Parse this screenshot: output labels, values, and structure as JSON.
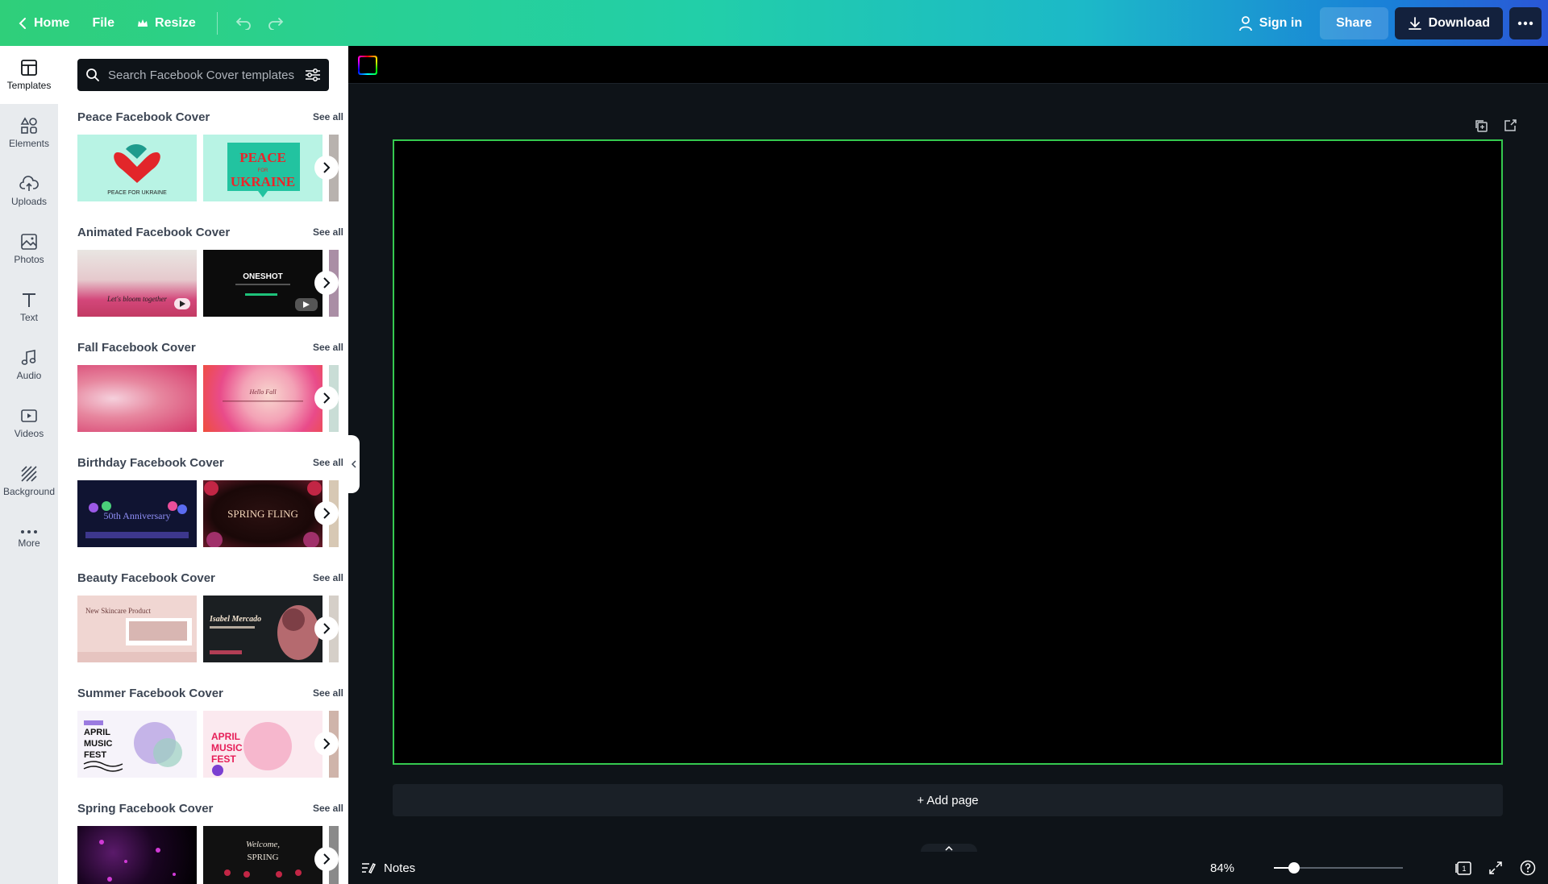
{
  "topbar": {
    "home_label": "Home",
    "file_label": "File",
    "resize_label": "Resize",
    "signin_label": "Sign in",
    "share_label": "Share",
    "download_label": "Download"
  },
  "rail": {
    "items": [
      {
        "label": "Templates",
        "icon": "templates-icon"
      },
      {
        "label": "Elements",
        "icon": "elements-icon"
      },
      {
        "label": "Uploads",
        "icon": "upload-cloud-icon"
      },
      {
        "label": "Photos",
        "icon": "photo-icon"
      },
      {
        "label": "Text",
        "icon": "text-icon"
      },
      {
        "label": "Audio",
        "icon": "audio-icon"
      },
      {
        "label": "Videos",
        "icon": "video-icon"
      },
      {
        "label": "Background",
        "icon": "background-icon"
      },
      {
        "label": "More",
        "icon": "more-dots-icon"
      }
    ]
  },
  "panel": {
    "search_placeholder": "Search Facebook Cover templates",
    "see_all": "See all",
    "sections": [
      {
        "title": "Peace Facebook Cover",
        "thumbs": [
          {
            "caption": "PEACE FOR UKRAINE"
          },
          {
            "caption": "PEACE FOR UKRAINE"
          }
        ]
      },
      {
        "title": "Animated Facebook Cover",
        "thumbs": [
          {
            "caption": "Let's bloom together"
          },
          {
            "caption": "ONESHOT"
          }
        ]
      },
      {
        "title": "Fall Facebook Cover",
        "thumbs": [
          {
            "caption": ""
          },
          {
            "caption": "Hello Fall"
          }
        ]
      },
      {
        "title": "Birthday Facebook Cover",
        "thumbs": [
          {
            "caption": "50th Anniversary"
          },
          {
            "caption": "SPRING FLING"
          }
        ]
      },
      {
        "title": "Beauty Facebook Cover",
        "thumbs": [
          {
            "caption": "New Skincare Product"
          },
          {
            "caption": "Isabel Mercado"
          }
        ]
      },
      {
        "title": "Summer Facebook Cover",
        "thumbs": [
          {
            "caption": "APRIL MUSIC FEST"
          },
          {
            "caption": "APRIL MUSIC FEST"
          }
        ]
      },
      {
        "title": "Spring Facebook Cover",
        "thumbs": [
          {
            "caption": ""
          },
          {
            "caption": "Welcome, SPRING"
          }
        ]
      }
    ]
  },
  "editor": {
    "add_page_label": "+ Add page",
    "canvas_border_color": "#35c94f"
  },
  "bottombar": {
    "notes_label": "Notes",
    "zoom_label": "84%",
    "zoom_value": 84,
    "page_count": "1"
  },
  "colors": {
    "topbar_gradient_start": "#2fcf7a",
    "topbar_gradient_end": "#2a56d6",
    "download_bg": "#13213d",
    "editor_bg": "#0e1318"
  }
}
